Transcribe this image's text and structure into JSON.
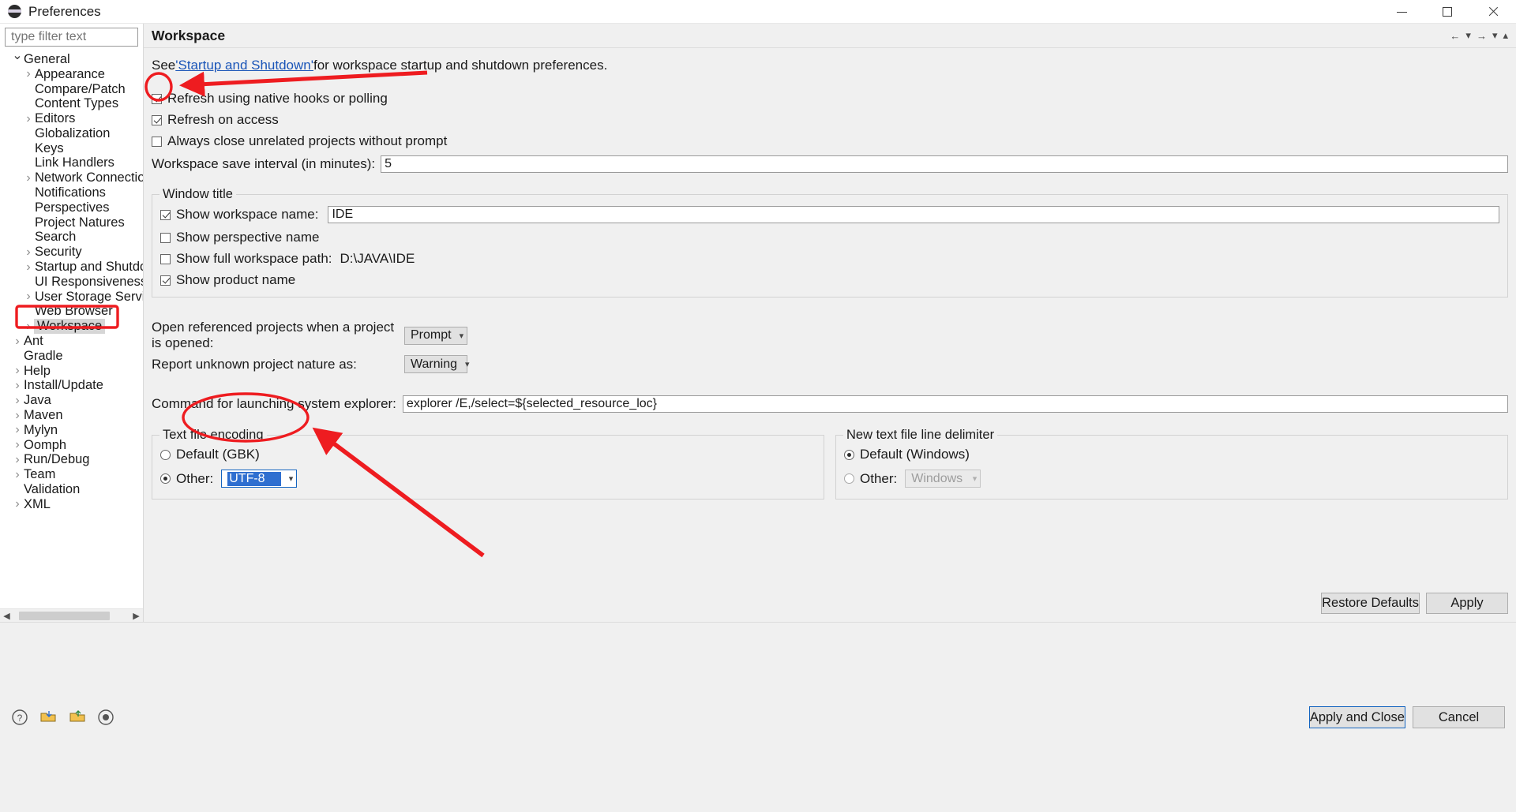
{
  "window": {
    "title": "Preferences",
    "icon": "eclipse-icon",
    "minimize_label": "Minimize",
    "maximize_label": "Maximize",
    "close_label": "Close"
  },
  "sidebar": {
    "filter_placeholder": "type filter text",
    "filter_value": "",
    "items": [
      {
        "label": "General",
        "indent": 0,
        "arrow": "down",
        "selected": false
      },
      {
        "label": "Appearance",
        "indent": 1,
        "arrow": "right",
        "selected": false
      },
      {
        "label": "Compare/Patch",
        "indent": 1,
        "arrow": "none",
        "selected": false
      },
      {
        "label": "Content Types",
        "indent": 1,
        "arrow": "none",
        "selected": false
      },
      {
        "label": "Editors",
        "indent": 1,
        "arrow": "right",
        "selected": false
      },
      {
        "label": "Globalization",
        "indent": 1,
        "arrow": "none",
        "selected": false
      },
      {
        "label": "Keys",
        "indent": 1,
        "arrow": "none",
        "selected": false
      },
      {
        "label": "Link Handlers",
        "indent": 1,
        "arrow": "none",
        "selected": false
      },
      {
        "label": "Network Connections",
        "indent": 1,
        "arrow": "right",
        "selected": false
      },
      {
        "label": "Notifications",
        "indent": 1,
        "arrow": "none",
        "selected": false
      },
      {
        "label": "Perspectives",
        "indent": 1,
        "arrow": "none",
        "selected": false
      },
      {
        "label": "Project Natures",
        "indent": 1,
        "arrow": "none",
        "selected": false
      },
      {
        "label": "Search",
        "indent": 1,
        "arrow": "none",
        "selected": false
      },
      {
        "label": "Security",
        "indent": 1,
        "arrow": "right",
        "selected": false
      },
      {
        "label": "Startup and Shutdown",
        "indent": 1,
        "arrow": "right",
        "selected": false
      },
      {
        "label": "UI Responsiveness Mo",
        "indent": 1,
        "arrow": "none",
        "selected": false
      },
      {
        "label": "User Storage Service",
        "indent": 1,
        "arrow": "right",
        "selected": false
      },
      {
        "label": "Web Browser",
        "indent": 1,
        "arrow": "none",
        "selected": false
      },
      {
        "label": "Workspace",
        "indent": 1,
        "arrow": "right",
        "selected": true
      },
      {
        "label": "Ant",
        "indent": 0,
        "arrow": "right",
        "selected": false
      },
      {
        "label": "Gradle",
        "indent": 0,
        "arrow": "none",
        "selected": false
      },
      {
        "label": "Help",
        "indent": 0,
        "arrow": "right",
        "selected": false
      },
      {
        "label": "Install/Update",
        "indent": 0,
        "arrow": "right",
        "selected": false
      },
      {
        "label": "Java",
        "indent": 0,
        "arrow": "right",
        "selected": false
      },
      {
        "label": "Maven",
        "indent": 0,
        "arrow": "right",
        "selected": false
      },
      {
        "label": "Mylyn",
        "indent": 0,
        "arrow": "right",
        "selected": false
      },
      {
        "label": "Oomph",
        "indent": 0,
        "arrow": "right",
        "selected": false
      },
      {
        "label": "Run/Debug",
        "indent": 0,
        "arrow": "right",
        "selected": false
      },
      {
        "label": "Team",
        "indent": 0,
        "arrow": "right",
        "selected": false
      },
      {
        "label": "Validation",
        "indent": 0,
        "arrow": "none",
        "selected": false
      },
      {
        "label": "XML",
        "indent": 0,
        "arrow": "right",
        "selected": false
      }
    ]
  },
  "page": {
    "title": "Workspace",
    "nav": {
      "back": "←",
      "back_menu": "▾",
      "forward": "→",
      "forward_menu": "▾",
      "collapse": "▴"
    },
    "intro_prefix": "See ",
    "intro_link": "'Startup and Shutdown'",
    "intro_suffix": " for workspace startup and shutdown preferences.",
    "checkboxes": [
      {
        "label": "Refresh using native hooks or polling",
        "checked": true
      },
      {
        "label": "Refresh on access",
        "checked": true
      },
      {
        "label": "Always close unrelated projects without prompt",
        "checked": false
      }
    ],
    "save_interval_label": "Workspace save interval (in minutes):",
    "save_interval_value": "5",
    "window_title_group": {
      "caption": "Window title",
      "show_workspace_name_label": "Show workspace name:",
      "show_workspace_name_checked": true,
      "workspace_name_value": "IDE",
      "show_perspective_name_label": "Show perspective name",
      "show_perspective_name_checked": false,
      "show_full_path_label": "Show full workspace path:",
      "show_full_path_checked": false,
      "full_path_value": "D:\\JAVA\\IDE",
      "show_product_name_label": "Show product name",
      "show_product_name_checked": true
    },
    "open_referenced_label": "Open referenced projects when a project is opened:",
    "open_referenced_value": "Prompt",
    "report_nature_label": "Report unknown project nature as:",
    "report_nature_value": "Warning",
    "explorer_command_label": "Command for launching system explorer:",
    "explorer_command_value": "explorer /E,/select=${selected_resource_loc}",
    "encoding_group": {
      "caption": "Text file encoding",
      "default_label": "Default (GBK)",
      "default_selected": false,
      "other_label": "Other:",
      "other_selected": true,
      "other_value": "UTF-8"
    },
    "delimiter_group": {
      "caption": "New text file line delimiter",
      "default_label": "Default (Windows)",
      "default_selected": true,
      "other_label": "Other:",
      "other_selected": false,
      "other_value": "Windows"
    },
    "restore_defaults_label": "Restore Defaults",
    "apply_label": "Apply"
  },
  "footer": {
    "help_icon": "help-question-icon",
    "import_icon": "import-icon",
    "export_icon": "export-icon",
    "record_icon": "record-icon",
    "apply_and_close_label": "Apply and Close",
    "cancel_label": "Cancel"
  },
  "annotations": {
    "color": "#ee1c20",
    "marks": [
      {
        "kind": "circle",
        "target": "refresh-native-hooks-checkbox"
      },
      {
        "kind": "arrow",
        "target": "refresh-native-hooks-checkbox"
      },
      {
        "kind": "rect",
        "target": "sidebar-item-workspace"
      },
      {
        "kind": "ellipse",
        "target": "encoding-other-combo"
      },
      {
        "kind": "arrow",
        "target": "encoding-other-combo"
      }
    ]
  }
}
